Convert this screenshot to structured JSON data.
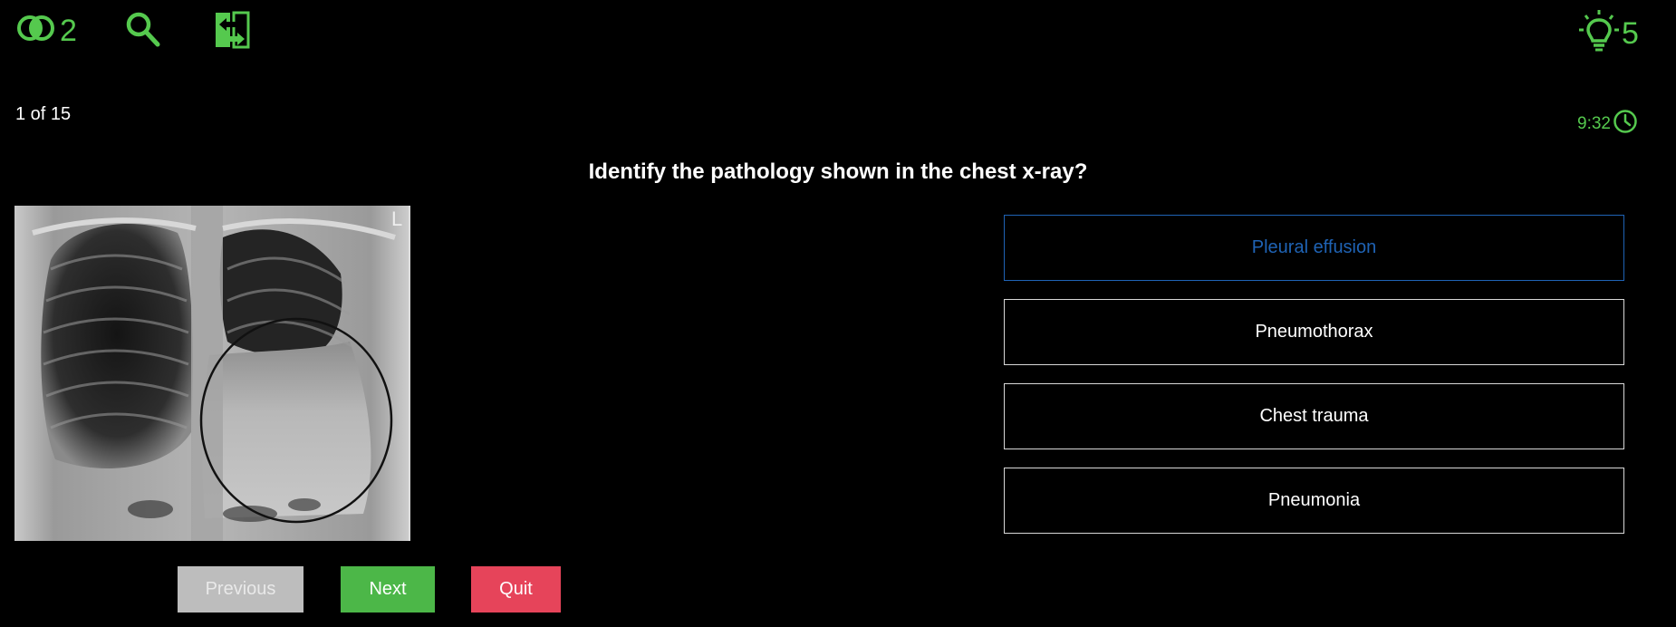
{
  "toolbar": {
    "fifty_fifty_count": "2",
    "hint_count": "5",
    "accent_color": "#55c94e"
  },
  "progress": {
    "text": "1 of 15"
  },
  "timer": {
    "text": "9:32"
  },
  "question": {
    "text": "Identify the pathology shown in the chest x-ray?"
  },
  "image": {
    "marker_label": "L"
  },
  "options": [
    {
      "label": "Pleural effusion",
      "selected": true
    },
    {
      "label": "Pneumothorax",
      "selected": false
    },
    {
      "label": "Chest trauma",
      "selected": false
    },
    {
      "label": "Pneumonia",
      "selected": false
    }
  ],
  "buttons": {
    "previous_label": "Previous",
    "next_label": "Next",
    "quit_label": "Quit"
  },
  "colors": {
    "selected_border": "#1f63b5",
    "next_bg": "#4cb748",
    "quit_bg": "#e6445a",
    "previous_bg": "#bdbdbd"
  }
}
